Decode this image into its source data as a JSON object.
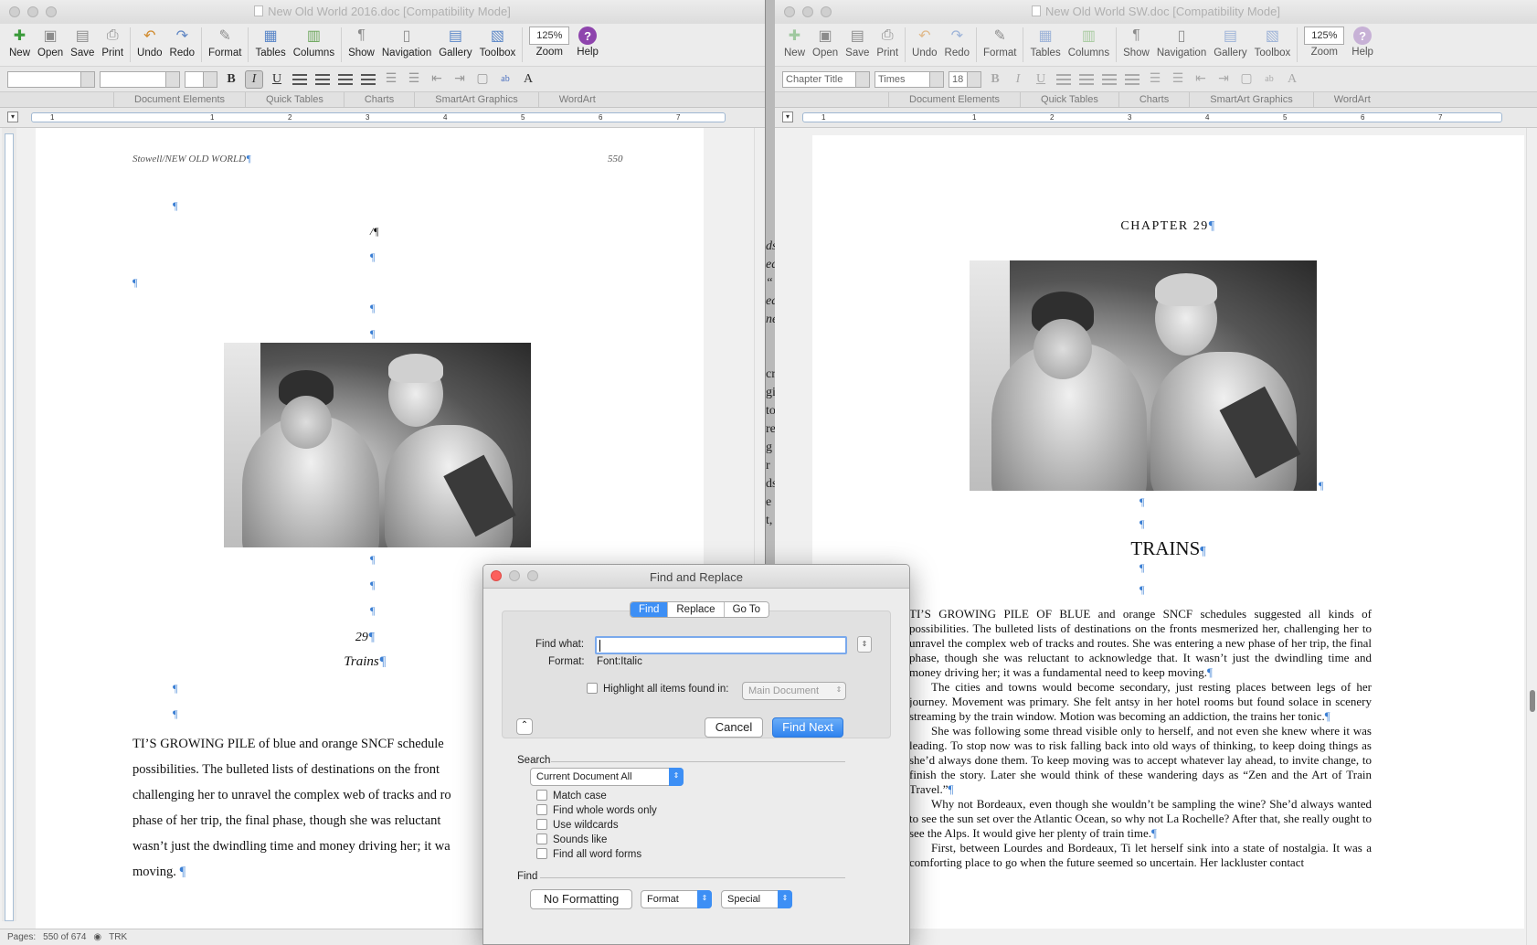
{
  "windows": {
    "left": {
      "title": "New Old World 2016.doc [Compatibility Mode]",
      "toolbar": {
        "new": "New",
        "open": "Open",
        "save": "Save",
        "print": "Print",
        "undo": "Undo",
        "redo": "Redo",
        "format": "Format",
        "tables": "Tables",
        "columns": "Columns",
        "show": "Show",
        "navigation": "Navigation",
        "gallery": "Gallery",
        "toolbox": "Toolbox",
        "zoom": "Zoom",
        "zoom_value": "125%",
        "help": "Help"
      },
      "format": {
        "style": "",
        "font": "",
        "size": ""
      },
      "ribbon": [
        "Document Elements",
        "Quick Tables",
        "Charts",
        "SmartArt Graphics",
        "WordArt"
      ],
      "page": {
        "header_left": "Stowell/NEW OLD WORLD",
        "header_right": "550",
        "chapter_number": "29",
        "chapter_title": "Trains",
        "lines": [
          "TI’S GROWING PILE of blue and orange SNCF schedule",
          "possibilities.  The bulleted lists of destinations on the front",
          "challenging her to unravel the complex web of tracks and ro",
          "phase of her trip, the final phase, though she was reluctant",
          "wasn’t just the dwindling time and money driving her; it wa",
          "moving."
        ]
      },
      "status": {
        "pages_label": "Pages:",
        "pages_value": "550 of 674",
        "trk": "TRK"
      }
    },
    "right": {
      "title": "New Old World SW.doc [Compatibility Mode]",
      "toolbar": {
        "new": "New",
        "open": "Open",
        "save": "Save",
        "print": "Print",
        "undo": "Undo",
        "redo": "Redo",
        "format": "Format",
        "tables": "Tables",
        "columns": "Columns",
        "show": "Show",
        "navigation": "Navigation",
        "gallery": "Gallery",
        "toolbox": "Toolbox",
        "zoom": "Zoom",
        "zoom_value": "125%",
        "help": "Help"
      },
      "format": {
        "style": "Chapter Title",
        "font": "Times",
        "size": "18"
      },
      "ribbon": [
        "Document Elements",
        "Quick Tables",
        "Charts",
        "SmartArt Graphics",
        "WordArt"
      ],
      "page": {
        "chapter_heading": "CHAPTER 29",
        "title": "TRAINS",
        "paragraphs": [
          "TI’S GROWING PILE OF BLUE and orange SNCF schedules suggested all kinds of possibilities.  The bulleted lists of destinations on the fronts mesmerized her, challenging her to unravel the complex web of tracks and routes.  She was entering a new phase of her trip, the final phase, though she was reluctant to acknowledge that.  It wasn’t just the dwindling time and money driving her; it was a fundamental need to keep moving.",
          "The cities and towns would become secondary, just resting places between legs of her journey.  Movement was primary.  She felt antsy in her hotel rooms but found solace in scenery streaming by the train window.  Motion was becoming an addiction, the trains her tonic.",
          "She was following some thread visible only to herself, and not even she knew where it was leading.  To stop now was to risk falling back into old ways of thinking, to keep doing things as she’d always done them.  To keep moving was to accept whatever lay ahead, to invite change, to finish the story.  Later she would think of these wandering days as “Zen and the Art of Train Travel.”",
          "Why not Bordeaux, even though she wouldn’t be sampling the wine?  She’d always wanted to see the sun set over the Atlantic Ocean, so why not La Rochelle?  After that, she really ought to see the Alps.  It would give her plenty of train time.",
          "First, between Lourdes and Bordeaux, Ti let herself sink into a state of nostalgia.  It was a comforting place to go when the future seemed so uncertain.  Her lackluster contact"
        ]
      }
    }
  },
  "dialog": {
    "title": "Find and Replace",
    "tabs": [
      "Find",
      "Replace",
      "Go To"
    ],
    "find_what_label": "Find what:",
    "find_what_value": "",
    "format_label": "Format:",
    "format_value": "Font:Italic",
    "highlight_label": "Highlight all items found in:",
    "highlight_scope": "Main Document",
    "cancel": "Cancel",
    "find_next": "Find Next",
    "search_label": "Search",
    "search_scope": "Current Document All",
    "options": [
      "Match case",
      "Find whole words only",
      "Use wildcards",
      "Sounds like",
      "Find all word forms"
    ],
    "find_label": "Find",
    "no_formatting": "No Formatting",
    "format_menu": "Format",
    "special_menu": "Special"
  },
  "behind_text_fragments": [
    "ds",
    "ed",
    "“",
    "ea",
    "ne",
    "cr",
    "gi",
    "to",
    "re",
    "g r",
    "ds",
    "e",
    "t,"
  ]
}
